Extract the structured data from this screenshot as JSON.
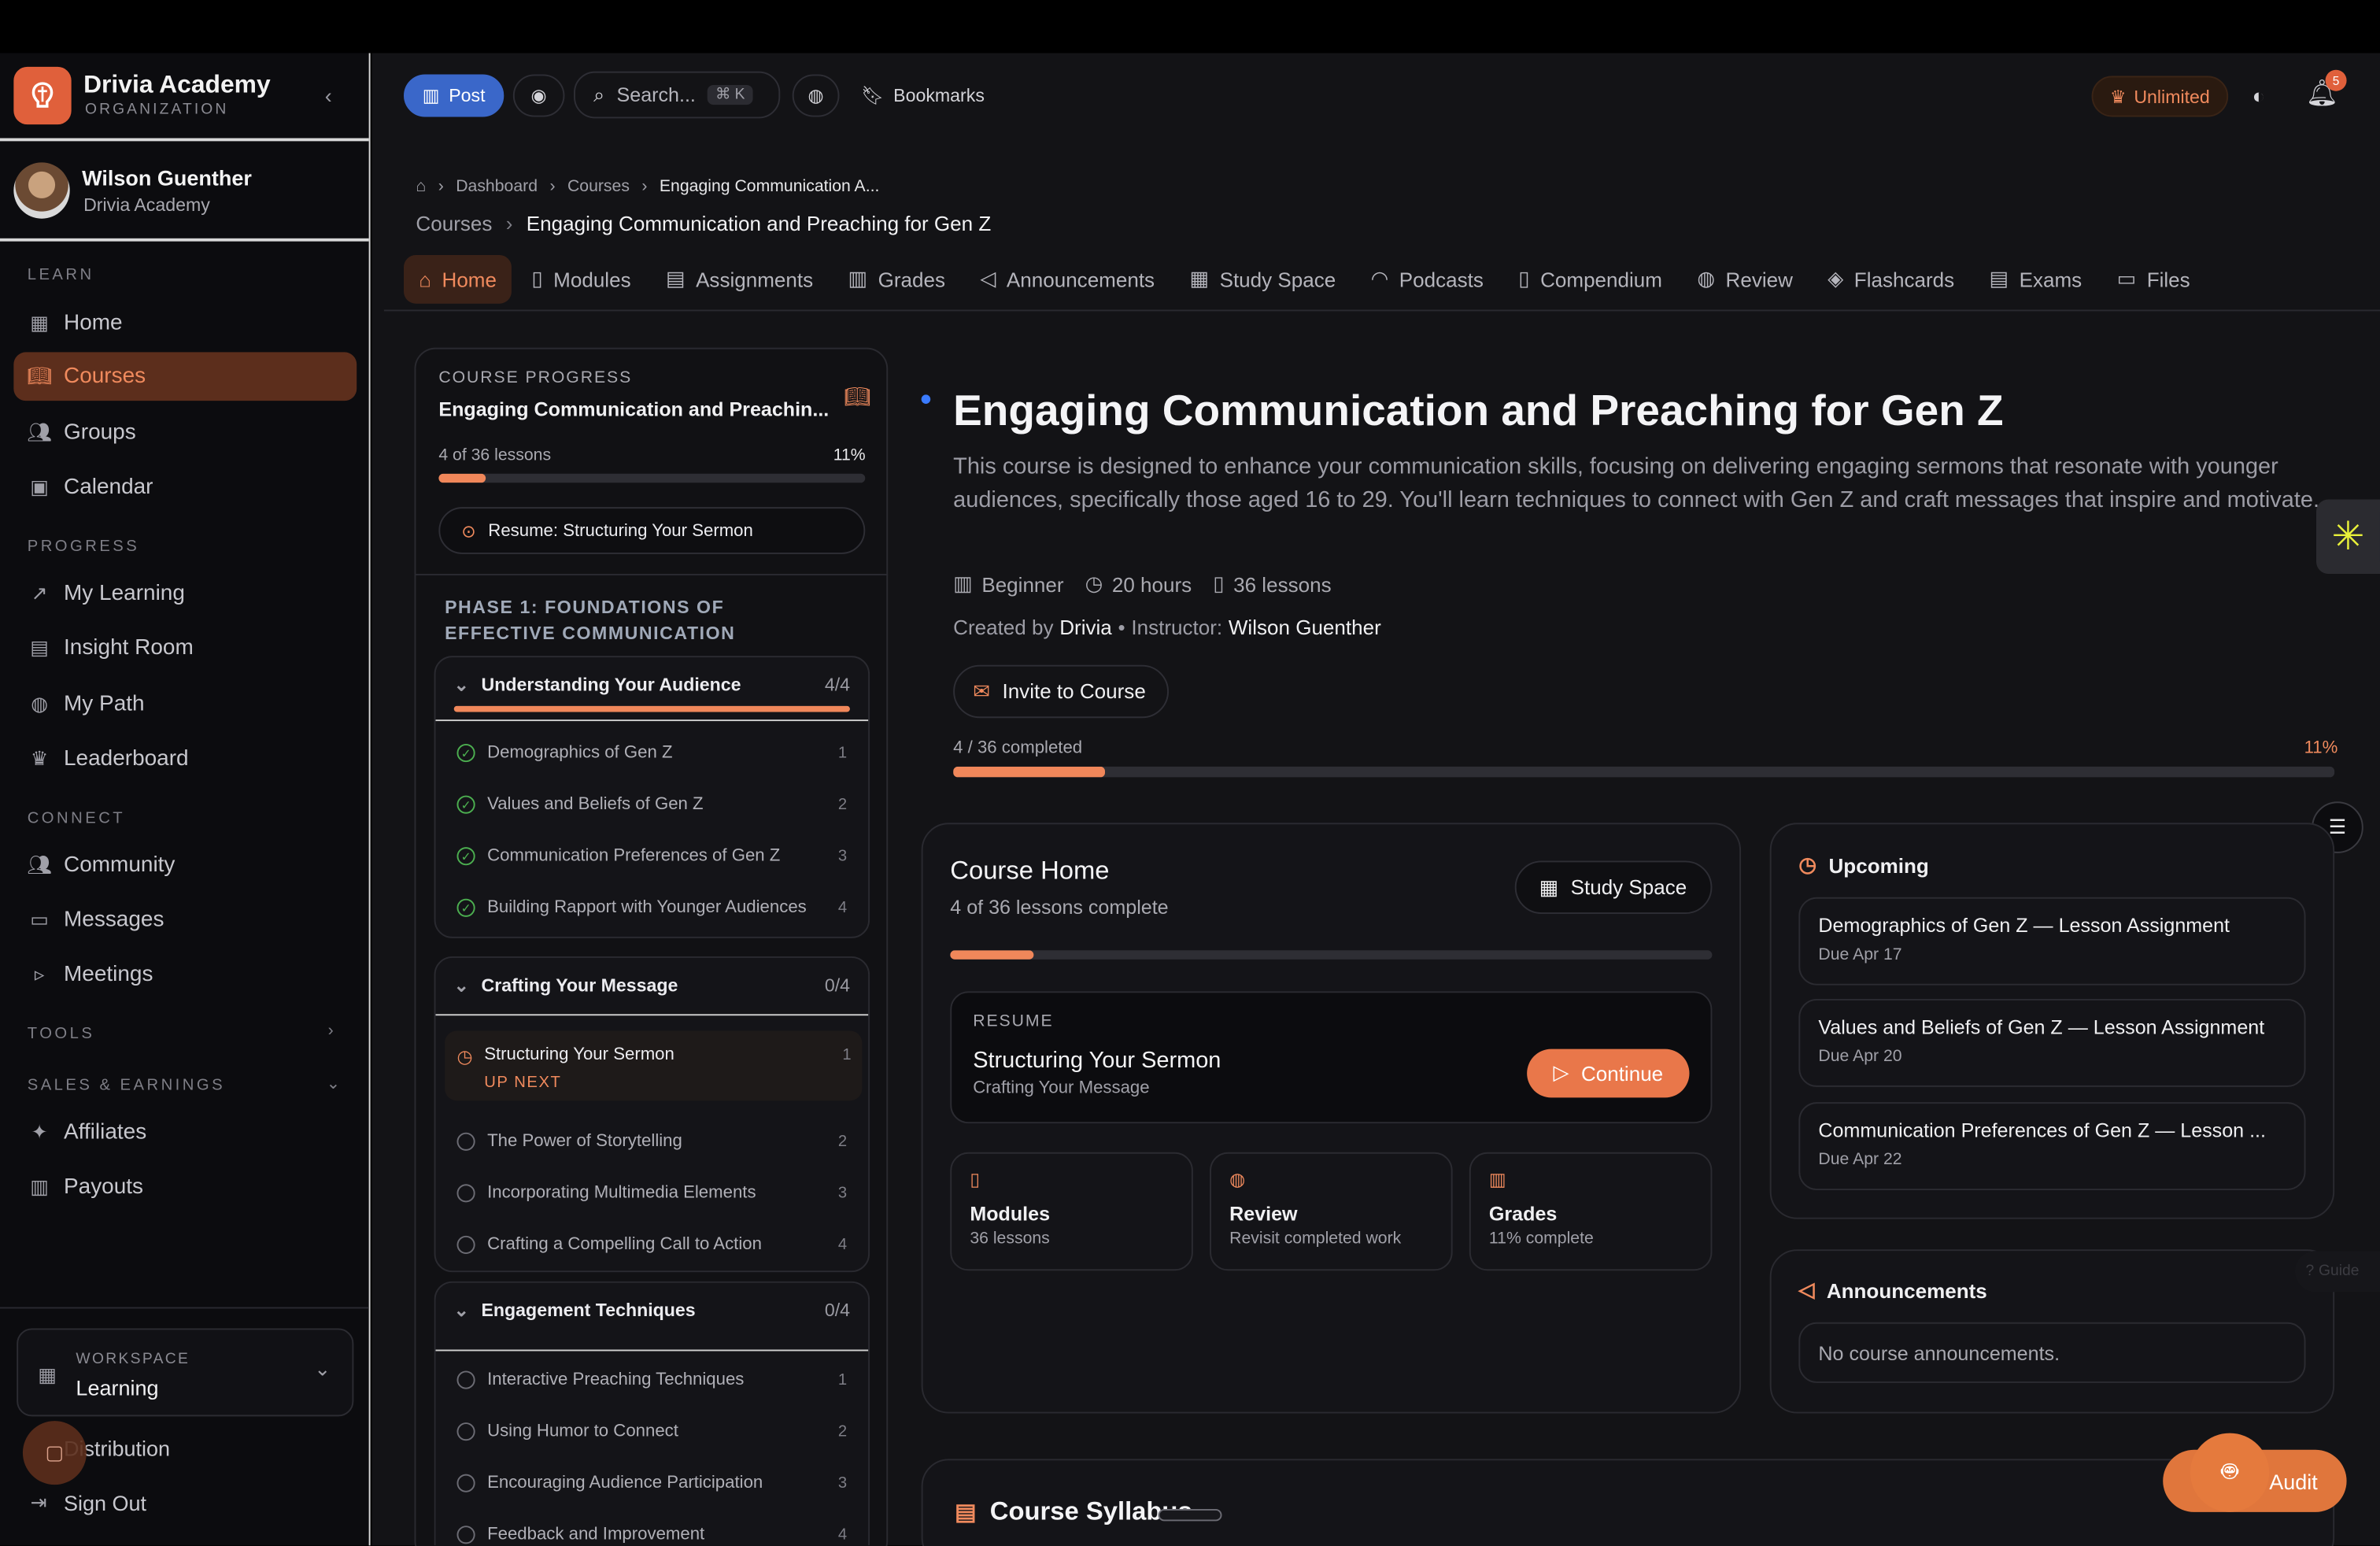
{
  "org": {
    "name": "Drivia Academy",
    "sub": "ORGANIZATION"
  },
  "user": {
    "name": "Wilson Guenther",
    "org": "Drivia Academy"
  },
  "sidebar": {
    "learn_title": "LEARN",
    "learn": [
      {
        "label": "Home",
        "icon": "grid-icon"
      },
      {
        "label": "Courses",
        "icon": "book-icon"
      },
      {
        "label": "Groups",
        "icon": "users-icon"
      },
      {
        "label": "Calendar",
        "icon": "calendar-icon"
      }
    ],
    "progress_title": "PROGRESS",
    "progress": [
      {
        "label": "My Learning"
      },
      {
        "label": "Insight Room"
      },
      {
        "label": "My Path"
      },
      {
        "label": "Leaderboard"
      }
    ],
    "connect_title": "CONNECT",
    "connect": [
      {
        "label": "Community"
      },
      {
        "label": "Messages"
      },
      {
        "label": "Meetings"
      }
    ],
    "tools_title": "TOOLS",
    "sales_title": "SALES & EARNINGS",
    "sales": [
      {
        "label": "Affiliates"
      },
      {
        "label": "Payouts"
      }
    ],
    "workspace_label": "WORKSPACE",
    "workspace_value": "Learning",
    "distribution": "Distribution",
    "signout": "Sign Out"
  },
  "topbar": {
    "post": "Post",
    "search": "Search...",
    "shortcut": "⌘ K",
    "bookmarks": "Bookmarks",
    "plan": "Unlimited",
    "notif_count": "5"
  },
  "breadcrumb": {
    "items": [
      "Dashboard",
      "Courses",
      "Engaging Communication A..."
    ],
    "sub": [
      "Courses",
      "Engaging Communication and Preaching for Gen Z"
    ]
  },
  "tabs": [
    "Home",
    "Modules",
    "Assignments",
    "Grades",
    "Announcements",
    "Study Space",
    "Podcasts",
    "Compendium",
    "Review",
    "Flashcards",
    "Exams",
    "Files"
  ],
  "progress_card": {
    "label": "COURSE PROGRESS",
    "title": "Engaging Communication and Preachin...",
    "lessons": "4 of 36 lessons",
    "pct": "11%",
    "progress": 0.11,
    "resume": "Resume: Structuring Your Sermon"
  },
  "phase": "PHASE 1: FOUNDATIONS OF EFFECTIVE COMMUNICATION",
  "modules": [
    {
      "title": "Understanding Your Audience",
      "count": "4/4",
      "progress": 1.0,
      "lessons": [
        {
          "t": "Demographics of Gen Z",
          "n": "1"
        },
        {
          "t": "Values and Beliefs of Gen Z",
          "n": "2"
        },
        {
          "t": "Communication Preferences of Gen Z",
          "n": "3"
        },
        {
          "t": "Building Rapport with Younger Audiences",
          "n": "4"
        }
      ]
    },
    {
      "title": "Crafting Your Message",
      "count": "0/4",
      "current": {
        "t": "Structuring Your Sermon",
        "tag": "UP NEXT",
        "n": "1"
      },
      "lessons": [
        {
          "t": "The Power of Storytelling",
          "n": "2"
        },
        {
          "t": "Incorporating Multimedia Elements",
          "n": "3"
        },
        {
          "t": "Crafting a Compelling Call to Action",
          "n": "4"
        }
      ]
    },
    {
      "title": "Engagement Techniques",
      "count": "0/4",
      "lessons": [
        {
          "t": "Interactive Preaching Techniques",
          "n": "1"
        },
        {
          "t": "Using Humor to Connect",
          "n": "2"
        },
        {
          "t": "Encouraging Audience Participation",
          "n": "3"
        },
        {
          "t": "Feedback and Improvement",
          "n": "4"
        }
      ]
    }
  ],
  "course": {
    "title": "Engaging Communication and Preaching for Gen Z",
    "desc": "This course is designed to enhance your communication skills, focusing on delivering engaging sermons that resonate with younger audiences, specifically those aged 16 to 29. You'll learn techniques to connect with Gen Z and craft messages that inspire and motivate.",
    "level": "Beginner",
    "hours": "20 hours",
    "lessons": "36 lessons",
    "created_label": "Created by",
    "creator": "Drivia",
    "instructor_label": "Instructor:",
    "instructor": "Wilson Guenther",
    "invite": "Invite to Course",
    "completed": "4 / 36 completed",
    "pct": "11%",
    "progress": 0.11
  },
  "home_card": {
    "title": "Course Home",
    "sub": "4 of 36 lessons complete",
    "study": "Study Space",
    "progress": 0.11,
    "resume_label": "RESUME",
    "resume_title": "Structuring Your Sermon",
    "resume_sub": "Crafting Your Message",
    "continue": "Continue",
    "tiles": [
      {
        "title": "Modules",
        "sub": "36 lessons"
      },
      {
        "title": "Review",
        "sub": "Revisit completed work"
      },
      {
        "title": "Grades",
        "sub": "11% complete"
      }
    ]
  },
  "upcoming": {
    "title": "Upcoming",
    "items": [
      {
        "t": "Demographics of Gen Z — Lesson Assignment",
        "d": "Due Apr 17"
      },
      {
        "t": "Values and Beliefs of Gen Z — Lesson Assignment",
        "d": "Due Apr 20"
      },
      {
        "t": "Communication Preferences of Gen Z — Lesson ...",
        "d": "Due Apr 22"
      }
    ]
  },
  "announcements": {
    "title": "Announcements",
    "empty": "No course announcements."
  },
  "syllabus": "Course Syllabus",
  "guide": "Guide",
  "audit": "Audit",
  "colors": {
    "accent": "#f0875a",
    "active_bg": "#5c2e1c",
    "success": "#4caf50"
  }
}
